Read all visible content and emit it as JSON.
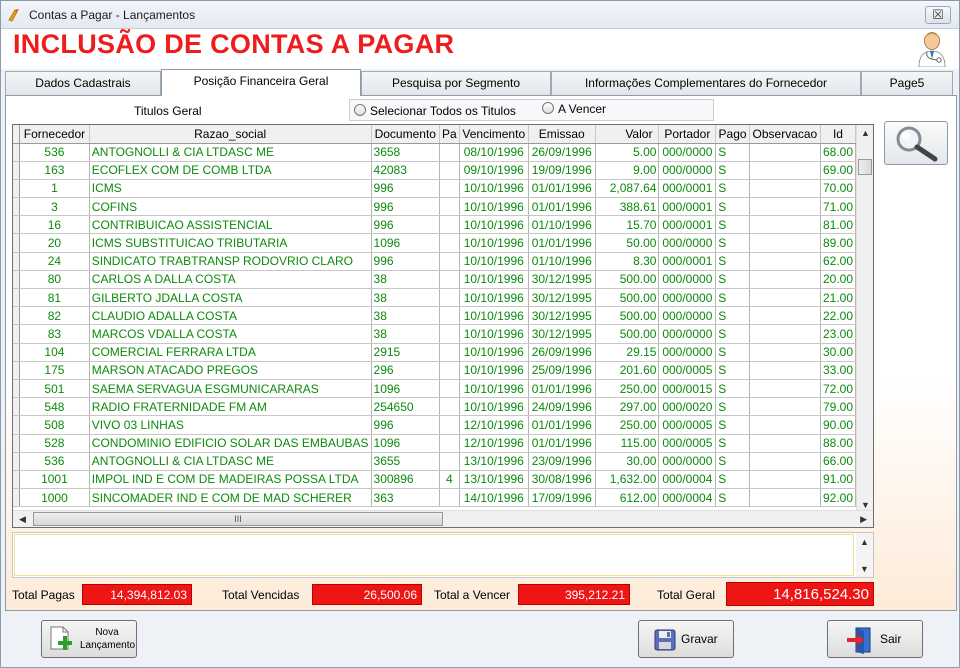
{
  "window": {
    "title": "Contas a Pagar - Lançamentos",
    "close_label": "☒"
  },
  "header": {
    "title": "INCLUSÃO DE CONTAS A PAGAR"
  },
  "tabs": [
    {
      "label": "Dados Cadastrais"
    },
    {
      "label": "Posição Financeira Geral"
    },
    {
      "label": "Pesquisa por Segmento"
    },
    {
      "label": "Informações Complementares do Fornecedor"
    },
    {
      "label": "Page5"
    }
  ],
  "filter": {
    "label": "Titulos Geral",
    "option_all": "Selecionar Todos os Titulos",
    "option_due": "A Vencer"
  },
  "grid": {
    "columns": [
      "Fornecedor",
      "Razao_social",
      "Documento",
      "Pa",
      "Vencimento",
      "Emissao",
      "Valor",
      "Portador",
      "Pago",
      "Observacao",
      "Id"
    ],
    "rows": [
      [
        "536",
        "ANTOGNOLLI & CIA LTDASC  ME",
        "3658",
        "",
        "08/10/1996",
        "26/09/1996",
        "5.00",
        "000/0000",
        "S",
        "",
        "68.00"
      ],
      [
        "163",
        "ECOFLEX COM DE COMB LTDA",
        "42083",
        "",
        "09/10/1996",
        "19/09/1996",
        "9.00",
        "000/0000",
        "S",
        "",
        "69.00"
      ],
      [
        "1",
        "ICMS",
        "996",
        "",
        "10/10/1996",
        "01/01/1996",
        "2,087.64",
        "000/0001",
        "S",
        "",
        "70.00"
      ],
      [
        "3",
        "COFINS",
        "996",
        "",
        "10/10/1996",
        "01/01/1996",
        "388.61",
        "000/0001",
        "S",
        "",
        "71.00"
      ],
      [
        "16",
        "CONTRIBUICAO ASSISTENCIAL",
        "996",
        "",
        "10/10/1996",
        "01/10/1996",
        "15.70",
        "000/0001",
        "S",
        "",
        "81.00"
      ],
      [
        "20",
        "ICMS  SUBSTITUICAO TRIBUTARIA",
        "1096",
        "",
        "10/10/1996",
        "01/01/1996",
        "50.00",
        "000/0000",
        "S",
        "",
        "89.00"
      ],
      [
        "24",
        "SINDICATO TRABTRANSP RODOVRIO CLARO",
        "996",
        "",
        "10/10/1996",
        "01/10/1996",
        "8.30",
        "000/0001",
        "S",
        "",
        "62.00"
      ],
      [
        "80",
        "CARLOS A DALLA COSTA",
        "38",
        "",
        "10/10/1996",
        "30/12/1995",
        "500.00",
        "000/0000",
        "S",
        "",
        "20.00"
      ],
      [
        "81",
        "GILBERTO JDALLA COSTA",
        "38",
        "",
        "10/10/1996",
        "30/12/1995",
        "500.00",
        "000/0000",
        "S",
        "",
        "21.00"
      ],
      [
        "82",
        "CLAUDIO ADALLA COSTA",
        "38",
        "",
        "10/10/1996",
        "30/12/1995",
        "500.00",
        "000/0000",
        "S",
        "",
        "22.00"
      ],
      [
        "83",
        "MARCOS VDALLA COSTA",
        "38",
        "",
        "10/10/1996",
        "30/12/1995",
        "500.00",
        "000/0000",
        "S",
        "",
        "23.00"
      ],
      [
        "104",
        "COMERCIAL FERRARA LTDA",
        "2915",
        "",
        "10/10/1996",
        "26/09/1996",
        "29.15",
        "000/0000",
        "S",
        "",
        "30.00"
      ],
      [
        "175",
        "MARSON  ATACADO PREGOS",
        "296",
        "",
        "10/10/1996",
        "25/09/1996",
        "201.60",
        "000/0005",
        "S",
        "",
        "33.00"
      ],
      [
        "501",
        "SAEMA  SERVAGUA ESGMUNICARARAS",
        "1096",
        "",
        "10/10/1996",
        "01/01/1996",
        "250.00",
        "000/0015",
        "S",
        "",
        "72.00"
      ],
      [
        "548",
        "RADIO FRATERNIDADE FM  AM",
        "254650",
        "",
        "10/10/1996",
        "24/09/1996",
        "297.00",
        "000/0020",
        "S",
        "",
        "79.00"
      ],
      [
        "508",
        "VIVO    03 LINHAS",
        "996",
        "",
        "12/10/1996",
        "01/01/1996",
        "250.00",
        "000/0005",
        "S",
        "",
        "90.00"
      ],
      [
        "528",
        "CONDOMINIO EDIFICIO SOLAR DAS EMBAUBAS",
        "1096",
        "",
        "12/10/1996",
        "01/01/1996",
        "115.00",
        "000/0005",
        "S",
        "",
        "88.00"
      ],
      [
        "536",
        "ANTOGNOLLI & CIA LTDASC  ME",
        "3655",
        "",
        "13/10/1996",
        "23/09/1996",
        "30.00",
        "000/0000",
        "S",
        "",
        "66.00"
      ],
      [
        "1001",
        "IMPOL IND E COM DE MADEIRAS POSSA LTDA",
        "300896",
        "4",
        "13/10/1996",
        "30/08/1996",
        "1,632.00",
        "000/0004",
        "S",
        "",
        "91.00"
      ],
      [
        "1000",
        "SINCOMADER IND E COM DE MAD SCHERER",
        "363",
        "",
        "14/10/1996",
        "17/09/1996",
        "612.00",
        "000/0004",
        "S",
        "",
        "92.00"
      ]
    ]
  },
  "scroll": {
    "h_thumb": "III"
  },
  "totals": {
    "pagas_label": "Total Pagas",
    "pagas_value": "14,394,812.03",
    "vencidas_label": "Total Vencidas",
    "vencidas_value": "26,500.06",
    "avencer_label": "Total a Vencer",
    "avencer_value": "395,212.21",
    "geral_label": "Total Geral",
    "geral_value": "14,816,524.30"
  },
  "buttons": {
    "novo_line1": "Nova",
    "novo_line2": "Lançamento",
    "gravar": "Gravar",
    "sair": "Sair"
  },
  "colors": {
    "title_red": "#ee1c1c",
    "data_green": "#0c8a0c",
    "total_box": "#ee1515"
  }
}
